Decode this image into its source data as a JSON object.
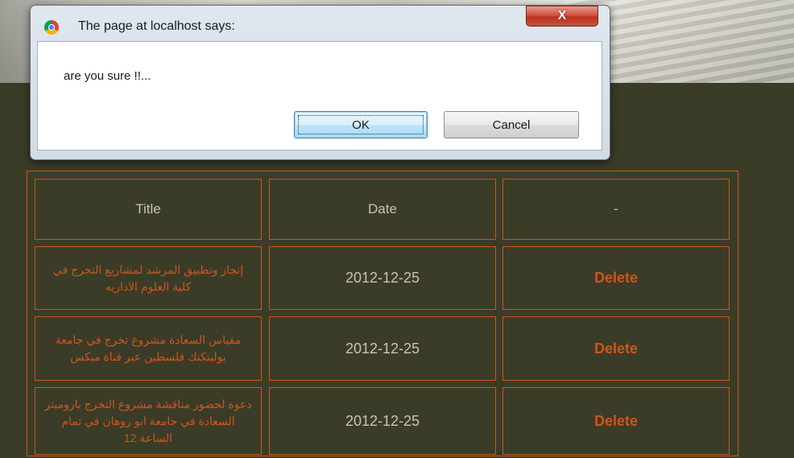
{
  "dialog": {
    "title": "The page at localhost says:",
    "message": "are you sure !!...",
    "ok_label": "OK",
    "cancel_label": "Cancel",
    "close_label": "X"
  },
  "table": {
    "headers": [
      "Title",
      "Date",
      "-"
    ],
    "rows": [
      {
        "title": "إنجاز وتطبيق المرشد لمشاريع التخرج في كلية العلوم الاداريه",
        "date": "2012-12-25",
        "action": "Delete"
      },
      {
        "title": "مقياس السعادة مشروع تخرج في جامعة بوليتكنك فلسطين عبر قناة ميكس",
        "date": "2012-12-25",
        "action": "Delete"
      },
      {
        "title": "دعوة لحضور مناقشة مشروع التخرج باروميتر السعادة في جامعة ابو روهان في تمام الساعة 12",
        "date": "2012-12-25",
        "action": "Delete"
      }
    ]
  },
  "colors": {
    "page_background": "#3a3c28",
    "accent": "#d0541a",
    "header_text": "#c8c4b0"
  },
  "icons": {
    "dialog_icon": "chrome-icon",
    "close_icon": "close-icon"
  }
}
